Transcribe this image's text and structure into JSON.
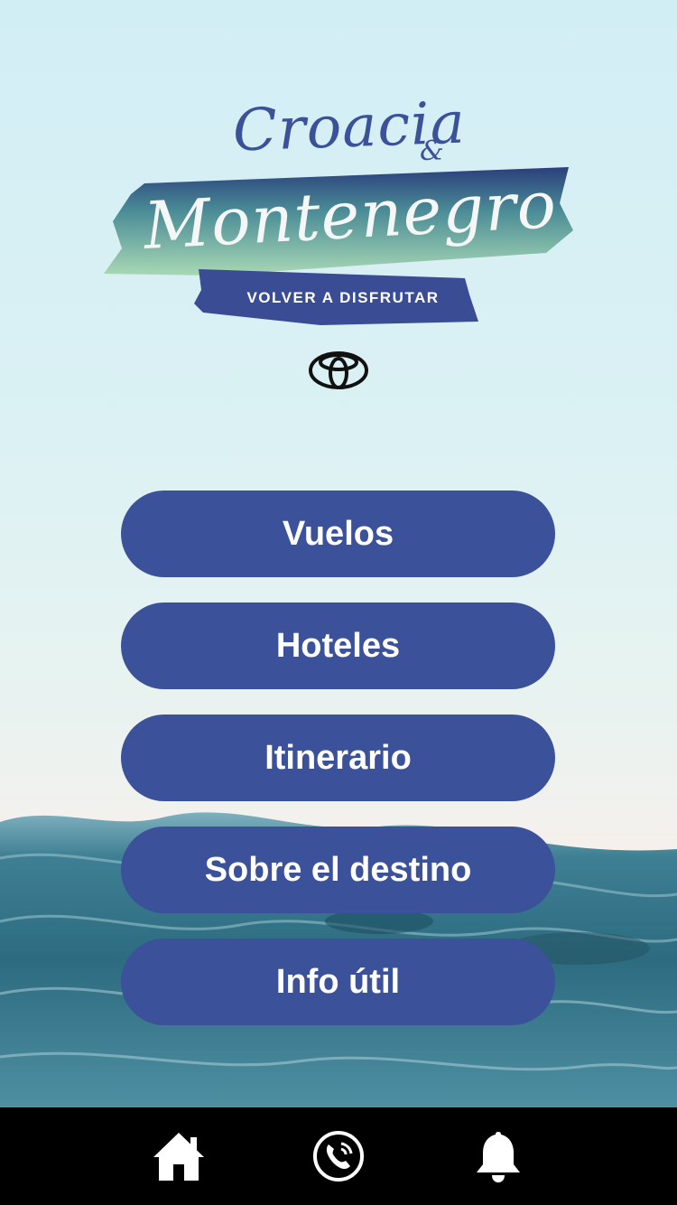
{
  "logo": {
    "title_top": "Croacia",
    "title_amp": "&",
    "title_main": "Montenegro",
    "tagline": "VOLVER A DISFRUTAR",
    "brand_icon": "toyota-logo"
  },
  "menu": {
    "items": [
      {
        "label": "Vuelos"
      },
      {
        "label": "Hoteles"
      },
      {
        "label": "Itinerario"
      },
      {
        "label": "Sobre el destino"
      },
      {
        "label": "Info útil"
      }
    ]
  },
  "tabbar": {
    "items": [
      {
        "icon": "home-icon"
      },
      {
        "icon": "phone-icon"
      },
      {
        "icon": "bell-icon"
      }
    ]
  },
  "colors": {
    "accent": "#3b5199",
    "tabbar_bg": "#000000",
    "sky_top": "#d2eef5",
    "sea": "#2f6b80"
  }
}
